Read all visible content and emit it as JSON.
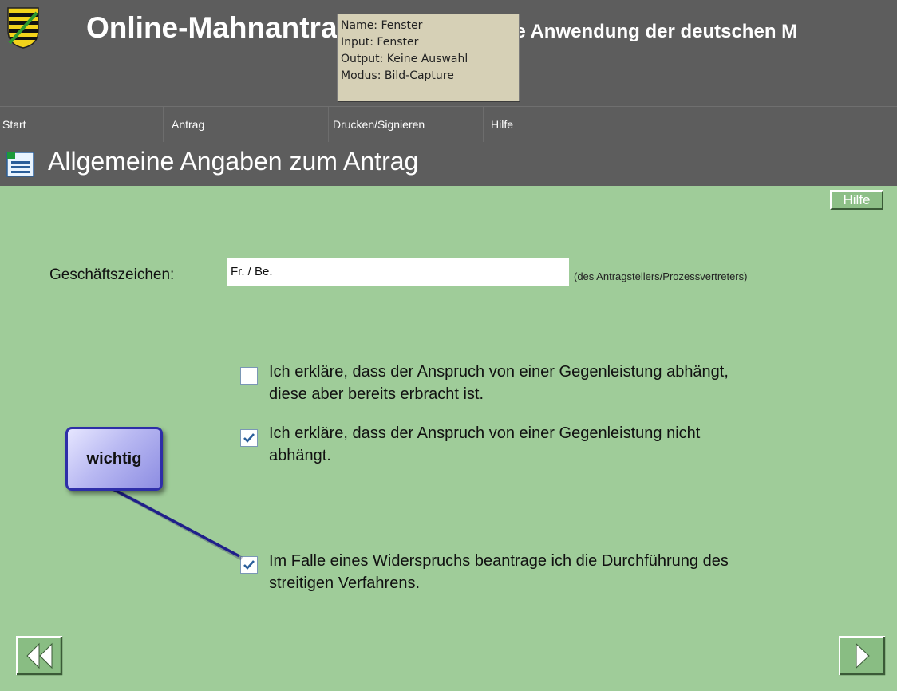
{
  "header": {
    "app_title": "Online-Mahnantrag",
    "app_subtitle": "Eine Anwendung der deutschen M",
    "tooltip": [
      "Name: Fenster",
      "Input: Fenster",
      "Output: Keine Auswahl",
      "Modus: Bild-Capture"
    ]
  },
  "menu": [
    {
      "label": "Start"
    },
    {
      "label": "Antrag"
    },
    {
      "label": "Drucken/Signieren"
    },
    {
      "label": "Hilfe"
    }
  ],
  "section": {
    "title": "Allgemeine Angaben zum Antrag"
  },
  "help_button": "Hilfe",
  "form": {
    "reference_label": "Geschäftszeichen:",
    "reference_value": "Fr. / Be.",
    "reference_hint": "(des Antragstellers/Prozessvertreters)",
    "options": [
      {
        "text_line1": "Ich erkläre, dass der Anspruch von einer Gegenleistung abhängt,",
        "text_line2": "diese aber bereits erbracht ist.",
        "checked": false
      },
      {
        "text_line1": "Ich erkläre, dass der Anspruch von einer Gegenleistung nicht",
        "text_line2": "abhängt.",
        "checked": true
      },
      {
        "text_line1": "Im Falle eines Widerspruchs beantrage ich die Durchführung des",
        "text_line2": "streitigen Verfahrens.",
        "checked": true
      }
    ]
  },
  "callout": {
    "text": "wichtig"
  },
  "icons": {
    "back": "double-left-arrow-icon",
    "forward": "right-arrow-icon",
    "seal": "coat-of-arms-icon",
    "section": "form-icon"
  },
  "colors": {
    "background": "#9fcc99",
    "header": "#5d5d5d",
    "callout_border": "#2e2ea8",
    "checkmark": "#2a5e9a"
  }
}
